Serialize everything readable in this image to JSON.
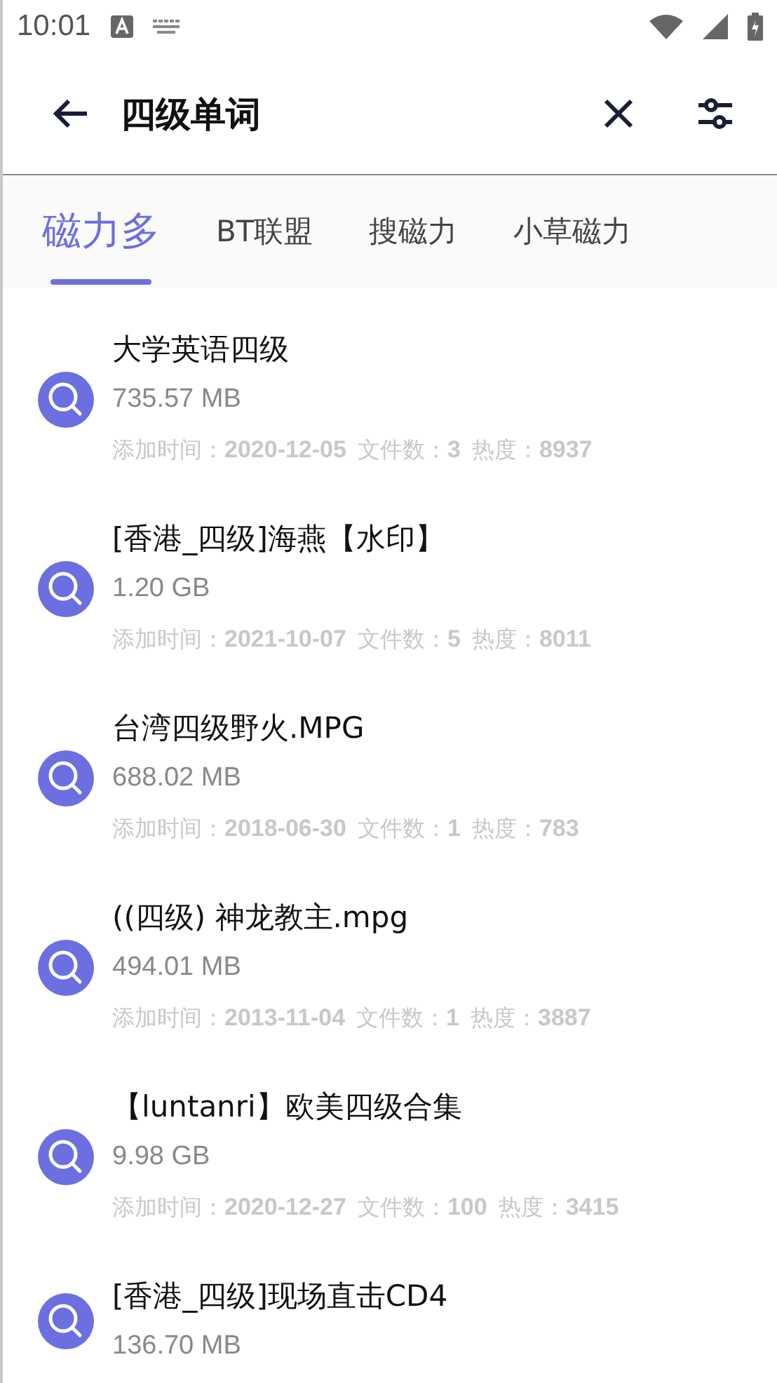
{
  "status_bar": {
    "time": "10:01"
  },
  "toolbar": {
    "query": "四级单词"
  },
  "tabs": [
    {
      "label": "磁力多",
      "selected": true
    },
    {
      "label": "BT联盟",
      "selected": false
    },
    {
      "label": "搜磁力",
      "selected": false
    },
    {
      "label": "小草磁力",
      "selected": false
    }
  ],
  "results": [
    {
      "title": "大学英语四级",
      "size": "735.57 MB",
      "meta": [
        {
          "label": "添加时间：",
          "value": "2020-12-05"
        },
        {
          "label": "文件数：",
          "value": "3"
        },
        {
          "label": "热度：",
          "value": "8937"
        }
      ]
    },
    {
      "title": "[香港_四级]海燕【水印】",
      "size": "1.20 GB",
      "meta": [
        {
          "label": "添加时间：",
          "value": "2021-10-07"
        },
        {
          "label": "文件数：",
          "value": "5"
        },
        {
          "label": "热度：",
          "value": "8011"
        }
      ]
    },
    {
      "title": "台湾四级野火.MPG",
      "size": "688.02 MB",
      "meta": [
        {
          "label": "添加时间：",
          "value": "2018-06-30"
        },
        {
          "label": "文件数：",
          "value": "1"
        },
        {
          "label": "热度：",
          "value": "783"
        }
      ]
    },
    {
      "title": "((四级) 神龙教主.mpg",
      "size": "494.01 MB",
      "meta": [
        {
          "label": "添加时间：",
          "value": "2013-11-04"
        },
        {
          "label": "文件数：",
          "value": "1"
        },
        {
          "label": "热度：",
          "value": "3887"
        }
      ]
    },
    {
      "title": "【luntanri】欧美四级合集",
      "size": "9.98 GB",
      "meta": [
        {
          "label": "添加时间：",
          "value": "2020-12-27"
        },
        {
          "label": "文件数：",
          "value": "100"
        },
        {
          "label": "热度：",
          "value": "3415"
        }
      ]
    },
    {
      "title": "[香港_四级]现场直击CD4",
      "size": "136.70 MB"
    }
  ]
}
